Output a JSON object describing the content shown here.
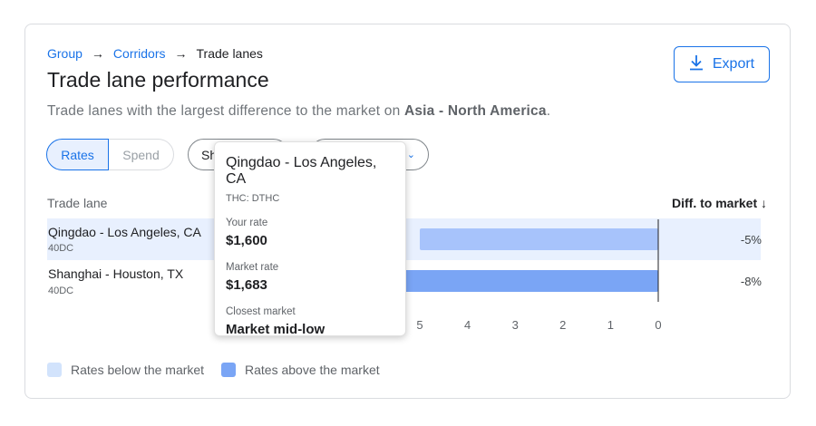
{
  "breadcrumb": {
    "items": [
      "Group",
      "Corridors"
    ],
    "current": "Trade lanes",
    "sep": "→"
  },
  "page": {
    "title": "Trade lane performance",
    "subtitle_prefix": "Trade lanes with the largest difference to the market on ",
    "subtitle_bold": "Asia - North America",
    "subtitle_suffix": "."
  },
  "export": {
    "label": "Export",
    "icon": "download-icon"
  },
  "toggle": {
    "rates": "Rates",
    "spend": "Spend",
    "selected": "Rates"
  },
  "filters": {
    "pill1_text": "Sh",
    "pill2_chevron": "⌄"
  },
  "table": {
    "col_lane": "Trade lane",
    "col_diff": "Diff. to market ↓"
  },
  "colors": {
    "accent": "#1a73e8",
    "below": "#a7c3fb",
    "above": "#7aa5f5",
    "below_swatch": "#d2e3fc"
  },
  "chart_data": {
    "type": "bar",
    "orientation": "horizontal",
    "categories": [
      "Qingdao - Los Angeles, CA",
      "Shanghai - Houston, TX"
    ],
    "subtitles": [
      "40DC",
      "40DC"
    ],
    "diff_labels": [
      "-5%",
      "-8%"
    ],
    "values": [
      5,
      8
    ],
    "x_ticks": [
      5,
      4,
      3,
      2,
      1,
      0
    ],
    "xlim": [
      0,
      9
    ],
    "series_colors": [
      "#a7c3fb",
      "#7aa5f5"
    ]
  },
  "legend": {
    "below": "Rates below the market",
    "above": "Rates above the market"
  },
  "tooltip": {
    "title": "Qingdao - Los Angeles, CA",
    "sub": "THC: DTHC",
    "your_rate_label": "Your rate",
    "your_rate": "$1,600",
    "market_rate_label": "Market rate",
    "market_rate": "$1,683",
    "closest_label": "Closest market",
    "closest": "Market mid-low"
  }
}
